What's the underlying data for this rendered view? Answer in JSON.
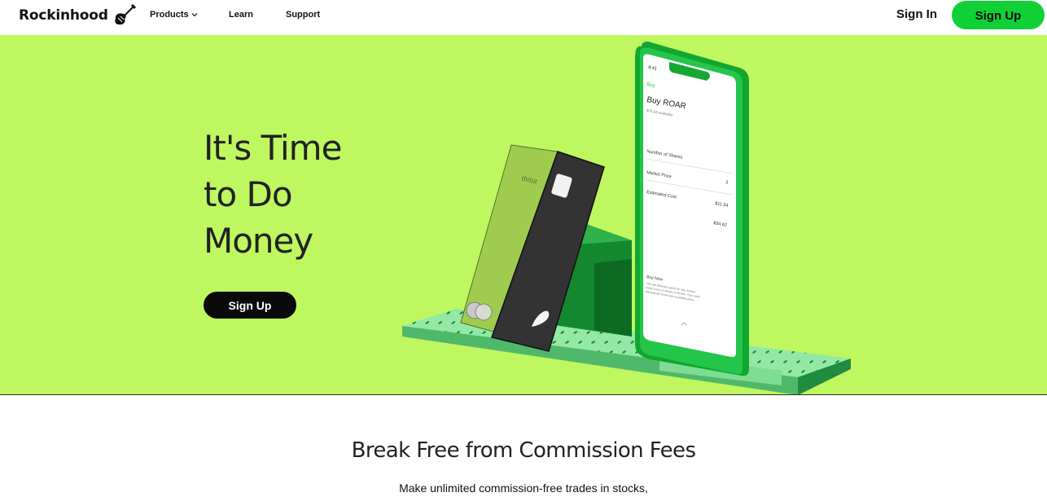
{
  "nav": {
    "brand": "Rockinhood",
    "brand_icon": "guitar-icon",
    "links": {
      "products": "Products",
      "learn": "Learn",
      "support": "Support"
    },
    "sign_in": "Sign In",
    "sign_up": "Sign Up"
  },
  "hero": {
    "title_lines": [
      "It's Time",
      "to Do",
      "Money"
    ],
    "cta": "Sign Up",
    "card": {
      "label": "debit"
    },
    "phone": {
      "time": "9:41",
      "back": "Buy",
      "title": "Buy ROAR",
      "subtitle": "$75.55 available",
      "rows": [
        {
          "label": "Number of Shares",
          "value": ""
        },
        {
          "label": "Market Price",
          "value": "3"
        },
        {
          "label": "Estimated Cost",
          "value": "$11.54"
        },
        {
          "label": "",
          "value": "$34.62"
        }
      ],
      "footer_title": "Buy Now",
      "footer_text": "You are placing a good for day market order to buy 3 shares of ROAR. Your order will execute at the best available price."
    }
  },
  "colors": {
    "hero_bg": "#bef75f",
    "accent_green": "#0fd136",
    "dark_button": "#0a0a0a"
  },
  "section": {
    "title": "Break Free from Commission Fees",
    "subtitle": "Make unlimited commission-free trades in stocks,"
  }
}
